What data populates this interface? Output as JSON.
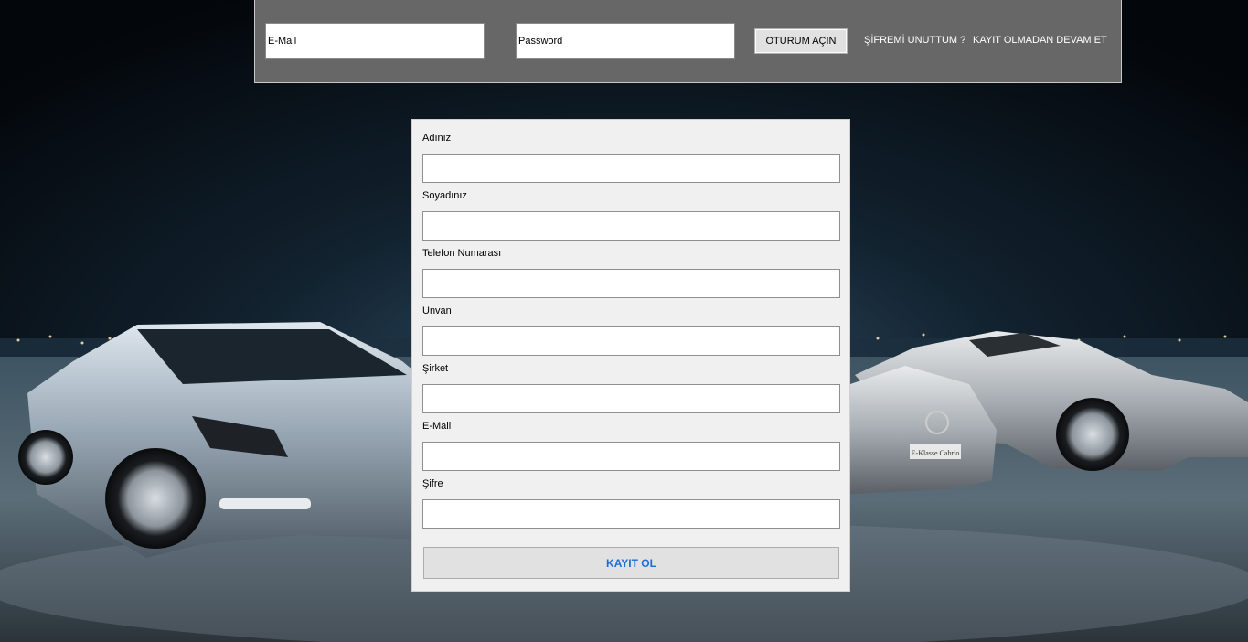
{
  "login_bar": {
    "email_value": "E-Mail",
    "password_placeholder": "Password",
    "login_button": "OTURUM AÇIN",
    "forgot_password_link": "ŞİFREMİ UNUTTUM ?",
    "continue_without_register_link": "KAYIT OLMADAN DEVAM ET"
  },
  "register_form": {
    "fields": [
      {
        "label": "Adınız"
      },
      {
        "label": "Soyadınız"
      },
      {
        "label": "Telefon Numarası"
      },
      {
        "label": "Unvan"
      },
      {
        "label": "Şirket"
      },
      {
        "label": "E-Mail"
      },
      {
        "label": "Şifre"
      }
    ],
    "submit_button": "KAYIT OL"
  },
  "background": {
    "plate_text": "E-Klasse Cabrio"
  },
  "colors": {
    "topbar_bg": "#676767",
    "panel_bg": "#f0f0f0",
    "submit_text": "#1a6fd6"
  }
}
